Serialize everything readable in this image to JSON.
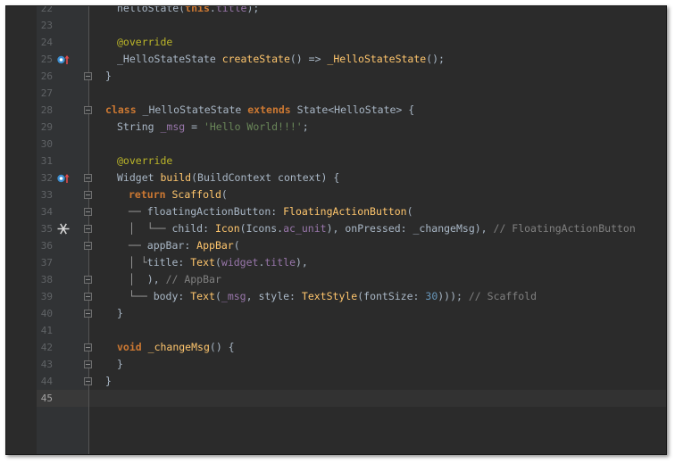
{
  "editor": {
    "language": "Dart",
    "current_line": "45",
    "lines": [
      {
        "n": "22",
        "indent": 1,
        "tokens": [
          [
            "t",
            "helloState("
          ],
          [
            "kw",
            "this"
          ],
          [
            "t",
            "."
          ],
          [
            "pr",
            "title"
          ],
          [
            "t",
            ");"
          ]
        ]
      },
      {
        "n": "23",
        "indent": 0,
        "tokens": []
      },
      {
        "n": "24",
        "indent": 1,
        "tokens": [
          [
            "an",
            "@override"
          ]
        ]
      },
      {
        "n": "25",
        "indent": 1,
        "icon": "override-marker",
        "tokens": [
          [
            "t",
            "_HelloStateState "
          ],
          [
            "fn",
            "createState"
          ],
          [
            "t",
            "() => "
          ],
          [
            "fn",
            "_HelloStateState"
          ],
          [
            "t",
            "();"
          ]
        ]
      },
      {
        "n": "26",
        "indent": 0,
        "fold": true,
        "tokens": [
          [
            "t",
            "}"
          ]
        ]
      },
      {
        "n": "27",
        "indent": 0,
        "tokens": []
      },
      {
        "n": "28",
        "indent": 0,
        "fold": true,
        "tokens": [
          [
            "kw",
            "class"
          ],
          [
            "t",
            " _HelloStateState "
          ],
          [
            "kw",
            "extends"
          ],
          [
            "t",
            " State<HelloState> {"
          ]
        ]
      },
      {
        "n": "29",
        "indent": 1,
        "tokens": [
          [
            "t",
            "String "
          ],
          [
            "pr",
            "_msg"
          ],
          [
            "t",
            " = "
          ],
          [
            "st",
            "'Hello World!!!'"
          ],
          [
            "t",
            ";"
          ]
        ]
      },
      {
        "n": "30",
        "indent": 0,
        "tokens": []
      },
      {
        "n": "31",
        "indent": 1,
        "tokens": [
          [
            "an",
            "@override"
          ]
        ]
      },
      {
        "n": "32",
        "indent": 1,
        "icon": "override-marker",
        "fold": true,
        "tokens": [
          [
            "t",
            "Widget "
          ],
          [
            "fn",
            "build"
          ],
          [
            "t",
            "(BuildContext context) {"
          ]
        ]
      },
      {
        "n": "33",
        "indent": 2,
        "fold": true,
        "tokens": [
          [
            "kw",
            "return"
          ],
          [
            "t",
            " "
          ],
          [
            "fn",
            "Scaffold"
          ],
          [
            "t",
            "("
          ]
        ]
      },
      {
        "n": "34",
        "indent": 2,
        "fold": true,
        "tokens": [
          [
            "tk",
            "── "
          ],
          [
            "t",
            "floatingActionButton: "
          ],
          [
            "fn",
            "FloatingActionButton"
          ],
          [
            "t",
            "("
          ]
        ]
      },
      {
        "n": "35",
        "indent": 2,
        "icon": "snowflake-icon",
        "fold": true,
        "tokens": [
          [
            "tk",
            "│  └── "
          ],
          [
            "t",
            "child: "
          ],
          [
            "fn",
            "Icon"
          ],
          [
            "t",
            "(Icons."
          ],
          [
            "pr",
            "ac_unit"
          ],
          [
            "t",
            "), onPressed: _changeMsg), "
          ],
          [
            "cm",
            "// FloatingActionButton"
          ]
        ]
      },
      {
        "n": "36",
        "indent": 2,
        "fold": true,
        "tokens": [
          [
            "tk",
            "── "
          ],
          [
            "t",
            "appBar: "
          ],
          [
            "fn",
            "AppBar"
          ],
          [
            "t",
            "("
          ]
        ]
      },
      {
        "n": "37",
        "indent": 2,
        "tokens": [
          [
            "tk",
            "│ └"
          ],
          [
            "t",
            "title: "
          ],
          [
            "fn",
            "Text"
          ],
          [
            "t",
            "("
          ],
          [
            "pr",
            "widget"
          ],
          [
            "t",
            "."
          ],
          [
            "pr",
            "title"
          ],
          [
            "t",
            "),"
          ]
        ]
      },
      {
        "n": "38",
        "indent": 2,
        "fold": true,
        "tokens": [
          [
            "tk",
            "│  "
          ],
          [
            "t",
            "), "
          ],
          [
            "cm",
            "// AppBar"
          ]
        ]
      },
      {
        "n": "39",
        "indent": 2,
        "fold": true,
        "tokens": [
          [
            "tk",
            "└── "
          ],
          [
            "t",
            "body: "
          ],
          [
            "fn",
            "Text"
          ],
          [
            "t",
            "("
          ],
          [
            "pr",
            "_msg"
          ],
          [
            "t",
            ", style: "
          ],
          [
            "fn",
            "TextStyle"
          ],
          [
            "t",
            "(fontSize: "
          ],
          [
            "nu",
            "30"
          ],
          [
            "t",
            "))); "
          ],
          [
            "cm",
            "// Scaffold"
          ]
        ]
      },
      {
        "n": "40",
        "indent": 1,
        "fold": true,
        "tokens": [
          [
            "t",
            "}"
          ]
        ]
      },
      {
        "n": "41",
        "indent": 0,
        "tokens": []
      },
      {
        "n": "42",
        "indent": 1,
        "fold": true,
        "tokens": [
          [
            "kw",
            "void"
          ],
          [
            "t",
            " "
          ],
          [
            "fn",
            "_changeMsg"
          ],
          [
            "t",
            "() {"
          ]
        ]
      },
      {
        "n": "43",
        "indent": 1,
        "fold": true,
        "tokens": [
          [
            "t",
            "}"
          ]
        ]
      },
      {
        "n": "44",
        "indent": 0,
        "fold": true,
        "tokens": [
          [
            "t",
            "}"
          ]
        ]
      },
      {
        "n": "45",
        "indent": 0,
        "tokens": []
      }
    ]
  },
  "colors": {
    "editor_bg": "#2b2b2b",
    "gutter_bg": "#313335",
    "keyword": "#cc7832",
    "function": "#ffc66d",
    "annotation": "#bbb529",
    "string": "#6a8759",
    "number": "#6897bb",
    "property": "#9876aa",
    "comment": "#808080",
    "text": "#a9b7c6"
  }
}
